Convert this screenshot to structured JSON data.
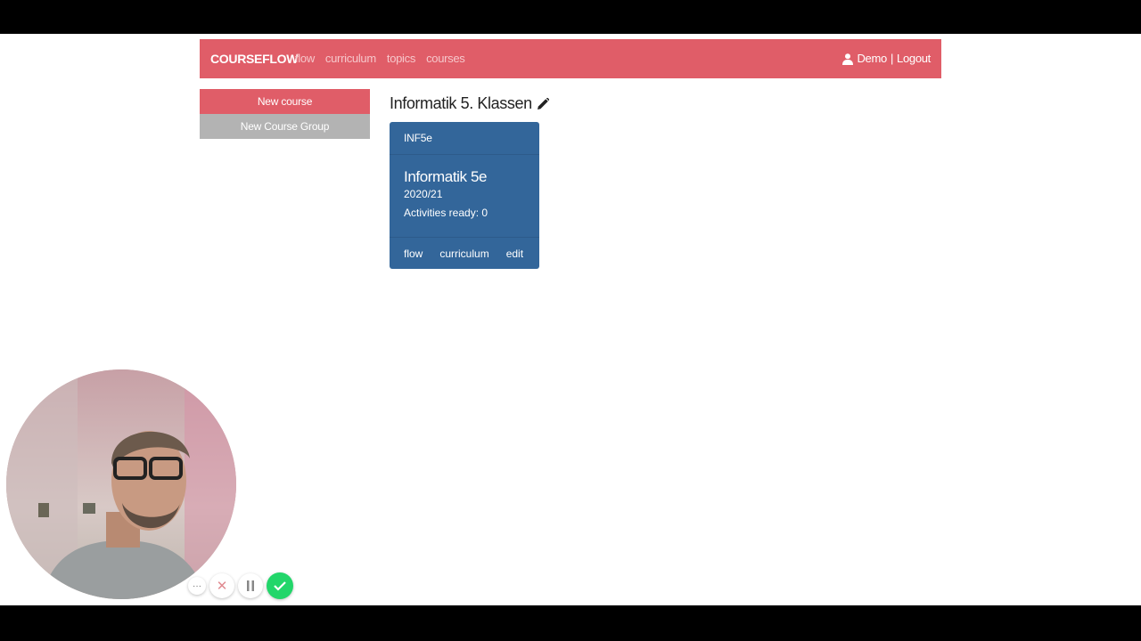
{
  "navbar": {
    "brand": "COURSEFLOW",
    "links": [
      "flow",
      "curriculum",
      "topics",
      "courses"
    ],
    "user": "Demo",
    "separator": "|",
    "logout": "Logout",
    "bg_color": "#e05d68"
  },
  "sidebar": {
    "new_course": "New course",
    "new_course_group": "New Course Group"
  },
  "main": {
    "title": "Informatik 5. Klassen",
    "card": {
      "code": "INF5e",
      "name": "Informatik 5e",
      "year": "2020/21",
      "activities": "Activities ready: 0",
      "actions": [
        "flow",
        "curriculum",
        "edit"
      ],
      "color": "#33669a"
    }
  },
  "recorder": {
    "more_label": "···",
    "close_label": "✕",
    "icons": [
      "more-icon",
      "close-icon",
      "pause-icon",
      "check-icon"
    ]
  }
}
